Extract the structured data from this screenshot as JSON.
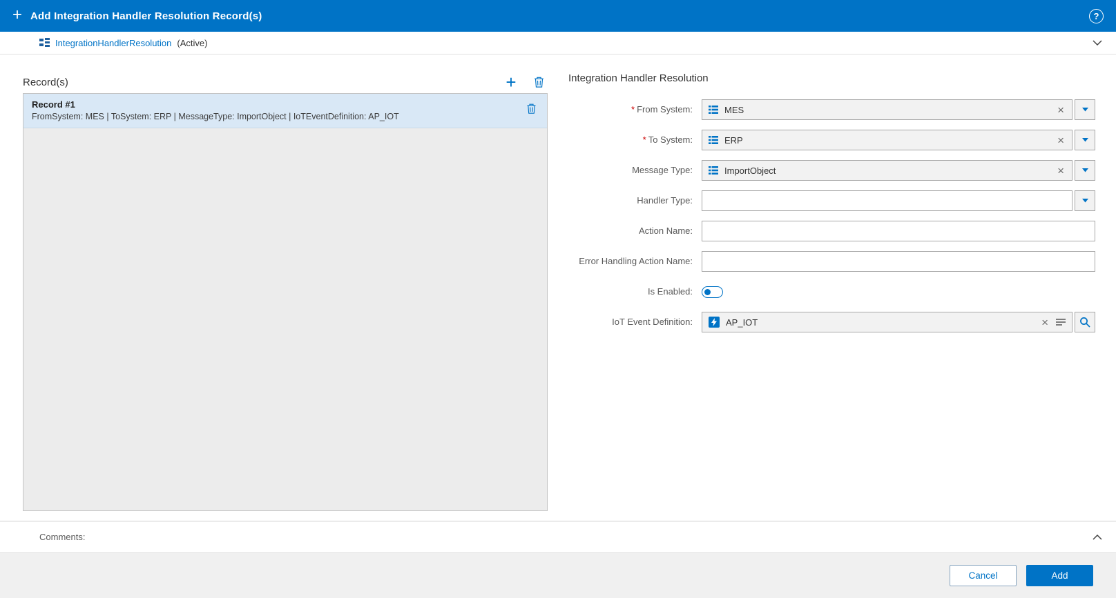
{
  "header": {
    "title": "Add Integration Handler Resolution Record(s)"
  },
  "icons": {
    "plus": "+",
    "help": "?",
    "clear": "×"
  },
  "subheader": {
    "entity_link": "IntegrationHandlerResolution",
    "status": "(Active)"
  },
  "records_panel": {
    "title": "Record(s)",
    "records": [
      {
        "title": "Record #1",
        "summary": "FromSystem: MES | ToSystem: ERP | MessageType: ImportObject | IoTEventDefinition: AP_IOT"
      }
    ]
  },
  "form": {
    "title": "Integration Handler Resolution",
    "required_marker": "*",
    "fields": {
      "from_system": {
        "label": "From System:",
        "required": true,
        "value": "MES"
      },
      "to_system": {
        "label": "To System:",
        "required": true,
        "value": "ERP"
      },
      "message_type": {
        "label": "Message Type:",
        "required": false,
        "value": "ImportObject"
      },
      "handler_type": {
        "label": "Handler Type:",
        "required": false,
        "value": ""
      },
      "action_name": {
        "label": "Action Name:",
        "required": false,
        "value": ""
      },
      "error_handling_action_name": {
        "label": "Error Handling Action Name:",
        "required": false,
        "value": ""
      },
      "is_enabled": {
        "label": "Is Enabled:",
        "value": false
      },
      "iot_event_definition": {
        "label": "IoT Event Definition:",
        "required": false,
        "value": "AP_IOT"
      }
    }
  },
  "comments": {
    "label": "Comments:"
  },
  "footer": {
    "cancel_label": "Cancel",
    "add_label": "Add"
  },
  "colors": {
    "accent": "#0073C6",
    "header_bg": "#0073C6",
    "selected_record_bg": "#d9e8f6",
    "list_bg": "#ececec",
    "field_filled_bg": "#f2f2f2",
    "border": "#a6a6a6",
    "footer_bg": "#f0f0f0",
    "required": "#cc0000"
  }
}
